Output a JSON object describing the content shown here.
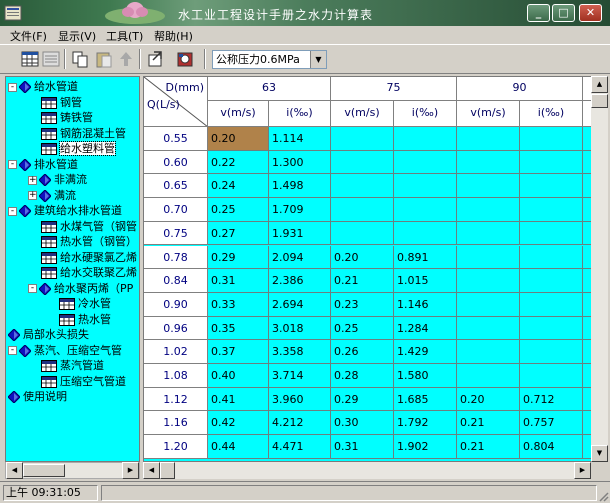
{
  "window": {
    "title": "水工业工程设计手册之水力计算表",
    "colors": {
      "titlebar": "#3f7a50",
      "panel_bg": "#00ffff",
      "selected_cell": "#b0824a"
    }
  },
  "menu": [
    "文件(F)",
    "显示(V)",
    "工具(T)",
    "帮助(H)"
  ],
  "toolbar": {
    "pressure_select": "公称压力0.6MPa",
    "icons": [
      "table-icon",
      "list-icon",
      "copy-icon",
      "paste-icon",
      "up-arrow-icon",
      "export-icon",
      "settings-icon"
    ]
  },
  "tree": [
    {
      "label": "给水管道",
      "level": 0,
      "icon": "diamond",
      "expander": "-"
    },
    {
      "label": "钢管",
      "level": 1,
      "icon": "table"
    },
    {
      "label": "铸铁管",
      "level": 1,
      "icon": "table"
    },
    {
      "label": "钢筋混凝土管",
      "level": 1,
      "icon": "table"
    },
    {
      "label": "给水塑料管",
      "level": 1,
      "icon": "table",
      "selected": true
    },
    {
      "label": "排水管道",
      "level": 0,
      "icon": "diamond",
      "expander": "-"
    },
    {
      "label": "非满流",
      "level": 1,
      "icon": "diamond",
      "expander": "+"
    },
    {
      "label": "满流",
      "level": 1,
      "icon": "diamond",
      "expander": "+"
    },
    {
      "label": "建筑给水排水管道",
      "level": 0,
      "icon": "diamond",
      "expander": "-"
    },
    {
      "label": "水煤气管（钢管",
      "level": 1,
      "icon": "table"
    },
    {
      "label": "热水管（钢管）",
      "level": 1,
      "icon": "table"
    },
    {
      "label": "给水硬聚氯乙烯",
      "level": 1,
      "icon": "table"
    },
    {
      "label": "给水交联聚乙烯",
      "level": 1,
      "icon": "table"
    },
    {
      "label": "给水聚丙烯（PP",
      "level": 1,
      "icon": "diamond",
      "expander": "-"
    },
    {
      "label": "冷水管",
      "level": 2,
      "icon": "table"
    },
    {
      "label": "热水管",
      "level": 2,
      "icon": "table"
    },
    {
      "label": "局部水头损失",
      "level": 0,
      "icon": "diamond"
    },
    {
      "label": "蒸汽、压缩空气管",
      "level": 0,
      "icon": "diamond",
      "expander": "-"
    },
    {
      "label": "蒸汽管道",
      "level": 1,
      "icon": "table"
    },
    {
      "label": "压缩空气管道",
      "level": 1,
      "icon": "table"
    },
    {
      "label": "使用说明",
      "level": 0,
      "icon": "diamond"
    }
  ],
  "grid": {
    "corner_top": "D(mm)",
    "corner_bottom": "Q(L/s)",
    "diameters": [
      "63",
      "75",
      "90"
    ],
    "subheaders": [
      "v(m/s)",
      "i(‰)",
      "v(m/s)",
      "i(‰)",
      "v(m/s)",
      "i(‰)"
    ],
    "partial_subheader": "v(",
    "rows": [
      {
        "q": "0.55",
        "values": [
          "0.20",
          "1.114",
          "",
          "",
          "",
          ""
        ]
      },
      {
        "q": "0.60",
        "values": [
          "0.22",
          "1.300",
          "",
          "",
          "",
          ""
        ]
      },
      {
        "q": "0.65",
        "values": [
          "0.24",
          "1.498",
          "",
          "",
          "",
          ""
        ]
      },
      {
        "q": "0.70",
        "values": [
          "0.25",
          "1.709",
          "",
          "",
          "",
          ""
        ]
      },
      {
        "q": "0.75",
        "values": [
          "0.27",
          "1.931",
          "",
          "",
          "",
          ""
        ]
      },
      {
        "q": "0.78",
        "values": [
          "0.29",
          "2.094",
          "0.20",
          "0.891",
          "",
          ""
        ]
      },
      {
        "q": "0.84",
        "values": [
          "0.31",
          "2.386",
          "0.21",
          "1.015",
          "",
          ""
        ]
      },
      {
        "q": "0.90",
        "values": [
          "0.33",
          "2.694",
          "0.23",
          "1.146",
          "",
          ""
        ]
      },
      {
        "q": "0.96",
        "values": [
          "0.35",
          "3.018",
          "0.25",
          "1.284",
          "",
          ""
        ]
      },
      {
        "q": "1.02",
        "values": [
          "0.37",
          "3.358",
          "0.26",
          "1.429",
          "",
          ""
        ]
      },
      {
        "q": "1.08",
        "values": [
          "0.40",
          "3.714",
          "0.28",
          "1.580",
          "",
          ""
        ]
      },
      {
        "q": "1.12",
        "values": [
          "0.41",
          "3.960",
          "0.29",
          "1.685",
          "0.20",
          "0.712"
        ]
      },
      {
        "q": "1.16",
        "values": [
          "0.42",
          "4.212",
          "0.30",
          "1.792",
          "0.21",
          "0.757"
        ]
      },
      {
        "q": "1.20",
        "values": [
          "0.44",
          "4.471",
          "0.31",
          "1.902",
          "0.21",
          "0.804"
        ]
      }
    ]
  },
  "status": {
    "time": "上午 09:31:05"
  }
}
